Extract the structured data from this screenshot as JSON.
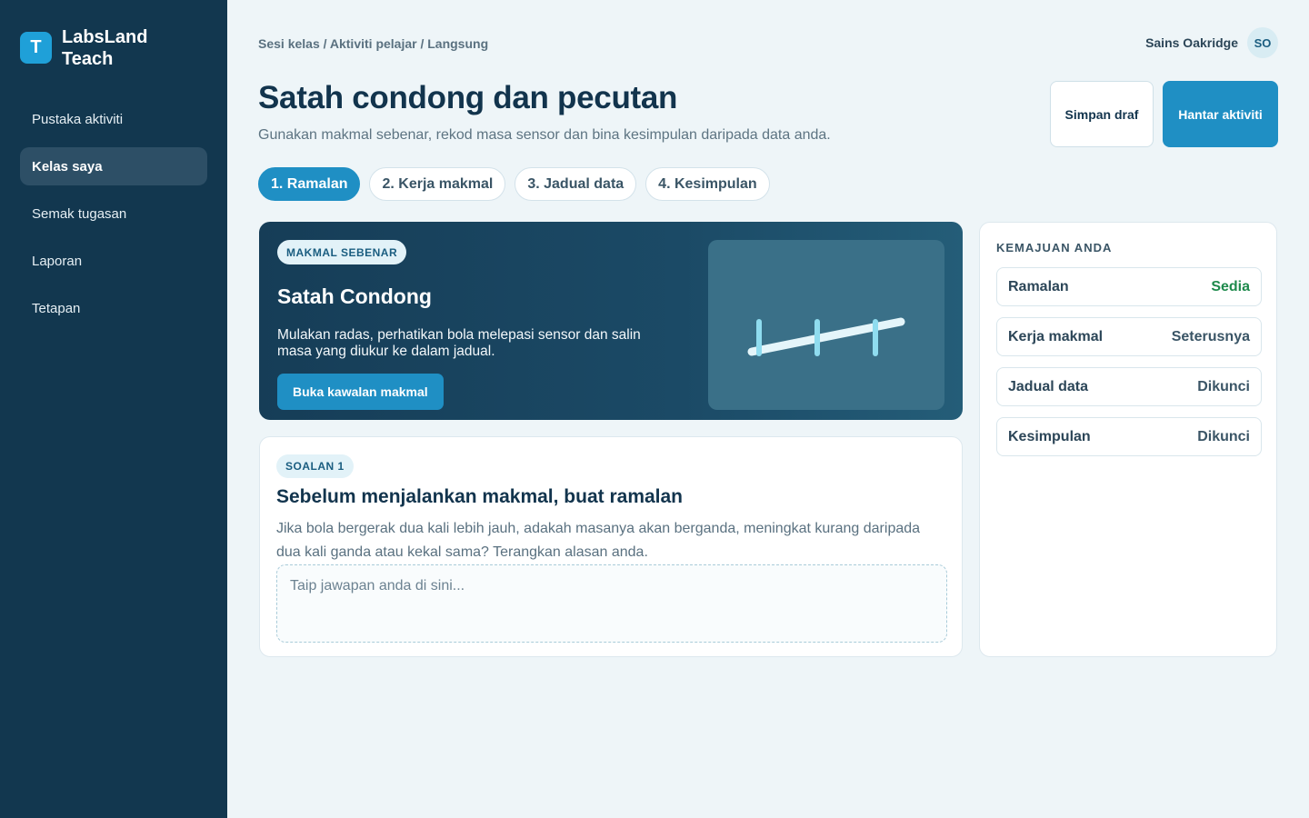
{
  "brand": {
    "logo_letter": "T",
    "name": "LabsLand Teach"
  },
  "sidebar": {
    "items": [
      {
        "label": "Pustaka aktiviti"
      },
      {
        "label": "Kelas saya"
      },
      {
        "label": "Semak tugasan"
      },
      {
        "label": "Laporan"
      },
      {
        "label": "Tetapan"
      }
    ],
    "active_index": 1
  },
  "breadcrumb": "Sesi kelas / Aktiviti pelajar / Langsung",
  "user": {
    "name": "Sains Oakridge",
    "initials": "SO"
  },
  "header": {
    "title": "Satah condong dan pecutan",
    "subtitle": "Gunakan makmal sebenar, rekod masa sensor dan bina kesimpulan daripada data anda.",
    "draft_label": "Simpan draf",
    "submit_label": "Hantar aktiviti"
  },
  "tabs": [
    {
      "label": "1. Ramalan"
    },
    {
      "label": "2. Kerja makmal"
    },
    {
      "label": "3. Jadual data"
    },
    {
      "label": "4. Kesimpulan"
    }
  ],
  "active_tab": 0,
  "lab": {
    "badge": "MAKMAL SEBENAR",
    "title": "Satah Condong",
    "description": "Mulakan radas, perhatikan bola melepasi sensor dan salin masa yang diukur ke dalam jadual.",
    "button_label": "Buka kawalan makmal",
    "visual_icon": "inclined-plane-illustration"
  },
  "question": {
    "badge": "SOALAN 1",
    "title": "Sebelum menjalankan makmal, buat ramalan",
    "text": "Jika bola bergerak dua kali lebih jauh, adakah masanya akan berganda, meningkat kurang daripada dua kali ganda atau kekal sama? Terangkan alasan anda.",
    "answer_value": "",
    "answer_placeholder": "Taip jawapan anda di sini..."
  },
  "progress": {
    "title": "KEMAJUAN ANDA",
    "items": [
      {
        "name": "Ramalan",
        "status": "Sedia",
        "status_color": "#1e8a4c"
      },
      {
        "name": "Kerja makmal",
        "status": "Seterusnya",
        "status_color": "#3a5566"
      },
      {
        "name": "Jadual data",
        "status": "Dikunci",
        "status_color": "#3a5566"
      },
      {
        "name": "Kesimpulan",
        "status": "Dikunci",
        "status_color": "#3a5566"
      }
    ]
  },
  "colors": {
    "sidebar_bg": "#12374f",
    "accent": "#1f8fc4",
    "ready": "#1e8a4c"
  }
}
